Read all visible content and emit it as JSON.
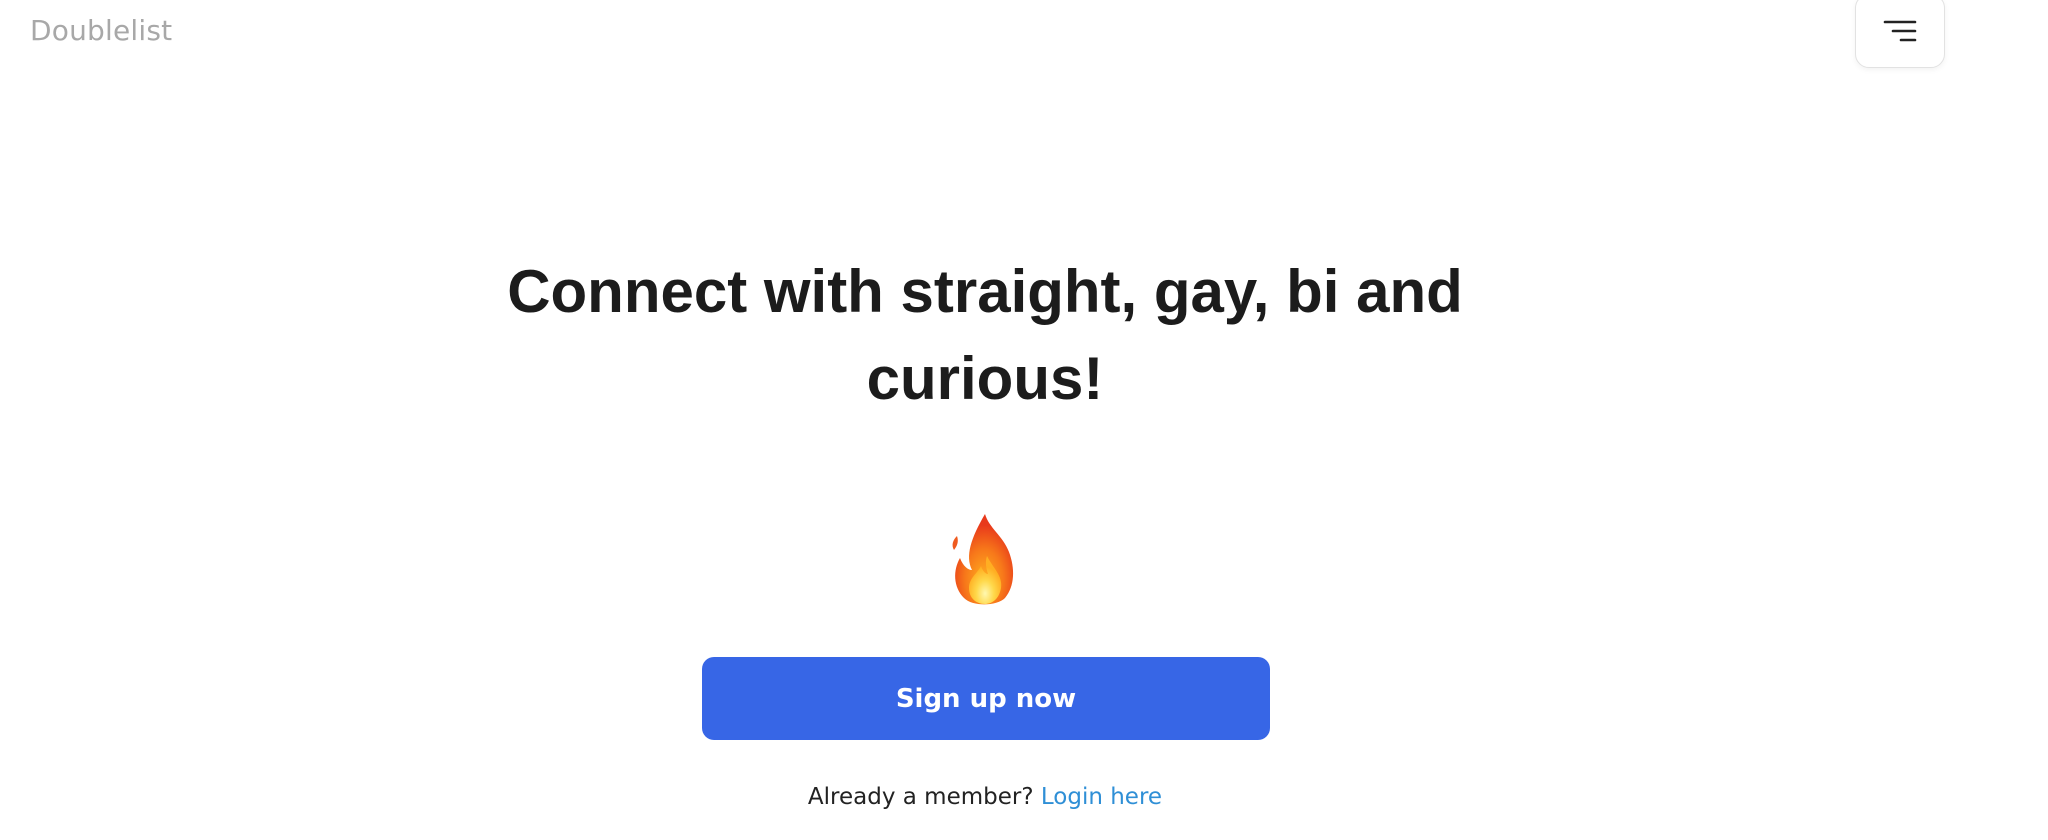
{
  "header": {
    "logo_text": "Doublelist",
    "menu_icon": "hamburger-menu-icon"
  },
  "hero": {
    "headline_line1": "Connect with straight, gay, bi and",
    "headline_line2": "curious!",
    "emoji_icon": "fire-icon"
  },
  "cta": {
    "signup_label": "Sign up now",
    "member_prompt": "Already a member?",
    "login_label": "Login here"
  },
  "colors": {
    "primary_button": "#3766e6",
    "link": "#2f8fd6",
    "logo": "#a8a8a8",
    "headline": "#1c1c1c"
  }
}
